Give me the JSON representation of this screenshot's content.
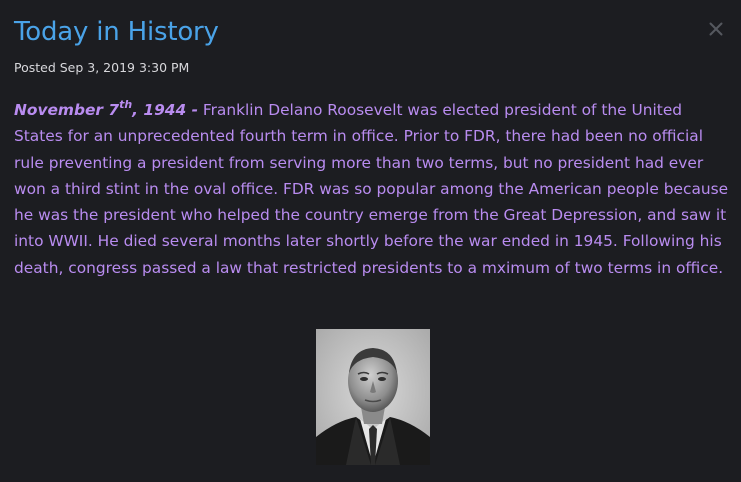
{
  "modal": {
    "title": "Today in History",
    "close_glyph": "×",
    "posted": "Posted Sep 3, 2019 3:30 PM"
  },
  "article": {
    "date_month_day": "November 7",
    "date_suffix": "th",
    "date_year": ", 1944 -",
    "body": " Franklin Delano Roosevelt was elected president of the United States for an unprecedented fourth term in office. Prior to FDR, there had been no official rule preventing a president from serving more than two terms, but no president had ever won a third stint in the oval office. FDR was so popular among the American people because he was the president who helped the country emerge from the Great Depression, and saw it into WWII. He died several months later shortly before the war ended in 1945. Following his death, congress passed a law that restricted presidents to a mximum of two terms in office."
  },
  "colors": {
    "background": "#1c1d21",
    "title": "#4aa3e8",
    "body_text": "#b98cf0",
    "meta_text": "#d8d8dc",
    "close_icon": "#55585f"
  },
  "icons": {
    "close": "close-icon",
    "photo": "portrait-photo"
  }
}
